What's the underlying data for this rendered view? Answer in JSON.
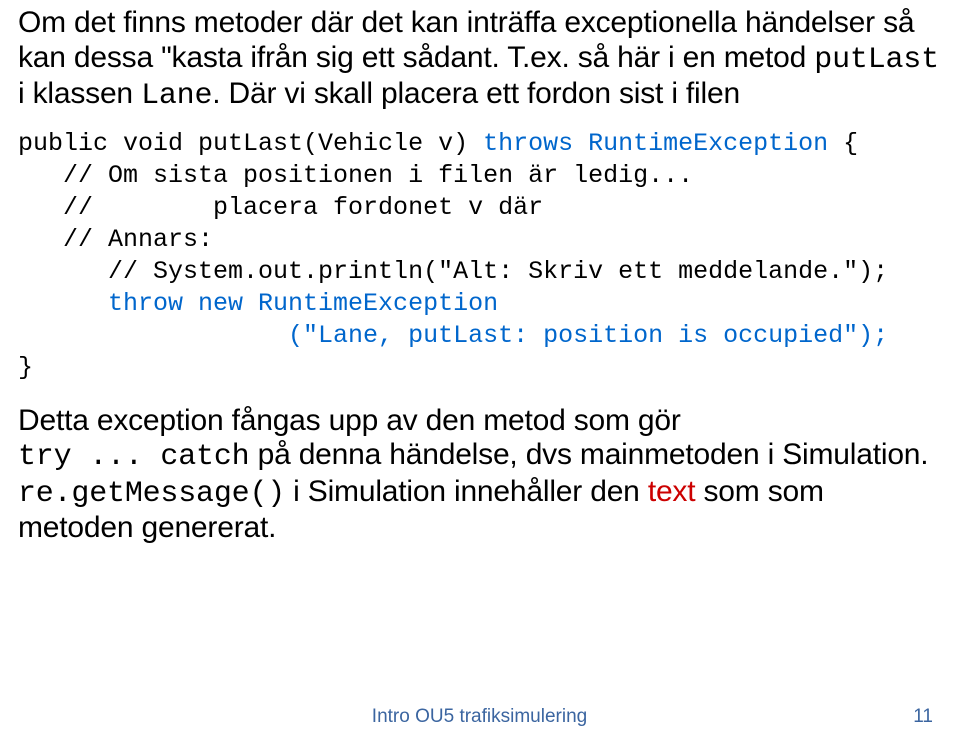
{
  "para1": {
    "pre": "Om det finns metoder där det kan inträffa exceptionella händelser så kan dessa \"kasta ifrån sig ett sådant. T.ex. så här i en metod ",
    "code1": "putLast",
    "mid": " i klassen ",
    "code2": "Lane",
    "post": ". Där vi skall placera ett fordon sist i filen"
  },
  "code": {
    "l1a": "public void putLast(Vehicle v) ",
    "l1b": "throws RuntimeException",
    "l1c": " {",
    "l2": "   // Om sista positionen i filen är ledig...",
    "l3": "   //        placera fordonet v där",
    "l4": "   // Annars:",
    "l5": "      // System.out.println(\"Alt: Skriv ett meddelande.\");",
    "l6": "      throw new RuntimeException",
    "l7": "                  (\"Lane, putLast: position is occupied\");",
    "l8": "}"
  },
  "para2": {
    "pre": "Detta exception fångas upp av den metod som gör",
    "code1": "try ... catch",
    "mid": "  på denna händelse, dvs mainmetoden i Simulation.",
    "code2": "re.getMessage()",
    "post_a": "  i Simulation innehåller den ",
    "red": "text",
    "post_b": " som som metoden genererat."
  },
  "footer": "Intro OU5 trafiksimulering",
  "page_number": "11"
}
